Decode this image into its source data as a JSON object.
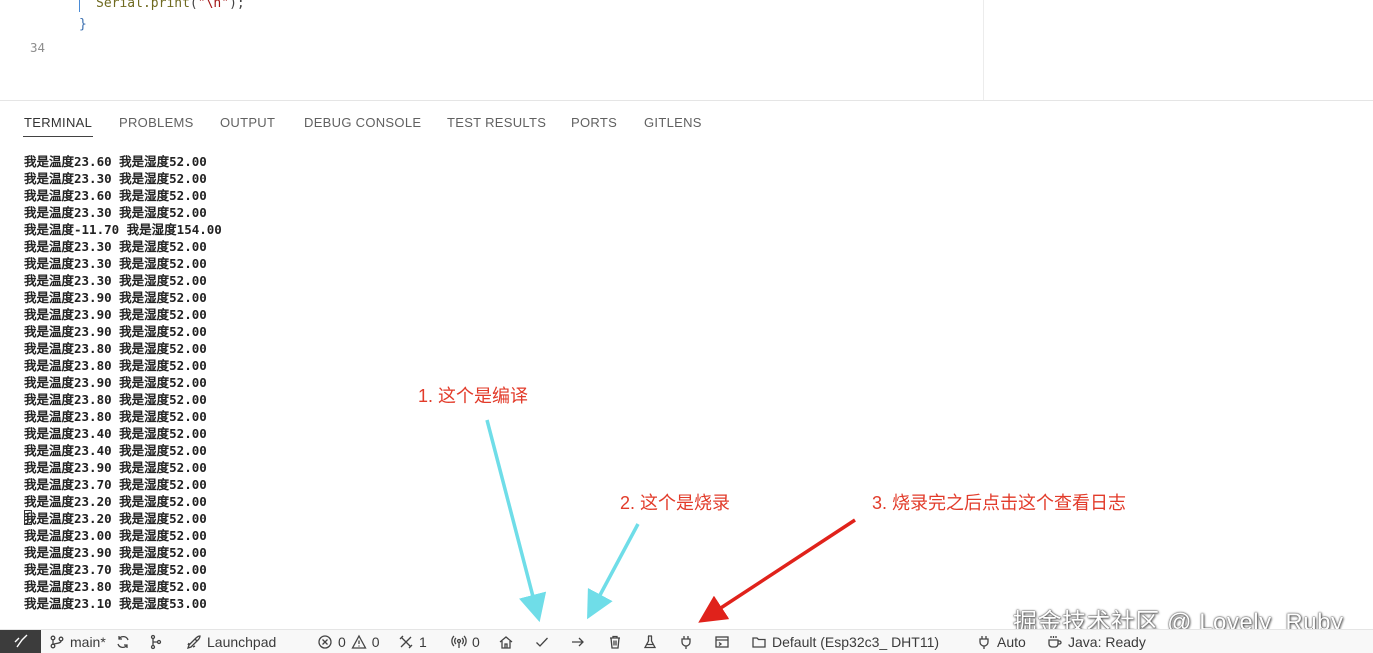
{
  "editor": {
    "line1": {
      "fn": "Serial.print",
      "open": "(",
      "str": "\"\\n\"",
      "close": ");"
    },
    "line2": "}",
    "line_number": "34"
  },
  "panel": {
    "tabs": [
      {
        "label": "TERMINAL",
        "active": true
      },
      {
        "label": "PROBLEMS",
        "active": false
      },
      {
        "label": "OUTPUT",
        "active": false
      },
      {
        "label": "DEBUG CONSOLE",
        "active": false
      },
      {
        "label": "TEST RESULTS",
        "active": false
      },
      {
        "label": "PORTS",
        "active": false
      },
      {
        "label": "GITLENS",
        "active": false
      }
    ]
  },
  "terminal": {
    "lines": [
      "我是温度23.60 我是湿度52.00",
      "我是温度23.30 我是湿度52.00",
      "我是温度23.60 我是湿度52.00",
      "我是温度23.30 我是湿度52.00",
      "我是温度-11.70 我是湿度154.00",
      "我是温度23.30 我是湿度52.00",
      "我是温度23.30 我是湿度52.00",
      "我是温度23.30 我是湿度52.00",
      "我是温度23.90 我是湿度52.00",
      "我是温度23.90 我是湿度52.00",
      "我是温度23.90 我是湿度52.00",
      "我是温度23.80 我是湿度52.00",
      "我是温度23.80 我是湿度52.00",
      "我是温度23.90 我是湿度52.00",
      "我是温度23.80 我是湿度52.00",
      "我是温度23.80 我是湿度52.00",
      "我是温度23.40 我是湿度52.00",
      "我是温度23.40 我是湿度52.00",
      "我是温度23.90 我是湿度52.00",
      "我是温度23.70 我是湿度52.00",
      "我是温度23.20 我是湿度52.00",
      "我是温度23.20 我是湿度52.00",
      "我是温度23.00 我是湿度52.00",
      "我是温度23.90 我是湿度52.00",
      "我是温度23.70 我是湿度52.00",
      "我是温度23.80 我是湿度52.00",
      "我是温度23.10 我是湿度53.00"
    ]
  },
  "annotations": {
    "compile": "1. 这个是编译",
    "upload": "2. 这个是烧录",
    "monitor": "3. 烧录完之后点击这个查看日志",
    "arrow_cyan": "#6fdde8",
    "arrow_red": "#e0221b"
  },
  "watermark": "掘金技术社区 @ Lovely_Ruby",
  "statusbar": {
    "branch": "main*",
    "launchpad": "Launchpad",
    "errors": "0",
    "warnings": "0",
    "tools": "1",
    "ports": "0",
    "env": "Default (Esp32c3_ DHT11)",
    "auto": "Auto",
    "java": "Java: Ready",
    "icons": [
      "remote-icon",
      "git-branch-icon",
      "sync-icon",
      "source-control-graph-icon",
      "rocket-icon",
      "error-icon",
      "warning-icon",
      "tools-icon",
      "broadcast-icon",
      "home-icon",
      "check-icon",
      "arrow-right-icon",
      "trash-icon",
      "flask-icon",
      "plug-icon",
      "terminal-icon",
      "folder-icon",
      "plug-icon",
      "coffee-icon"
    ]
  }
}
